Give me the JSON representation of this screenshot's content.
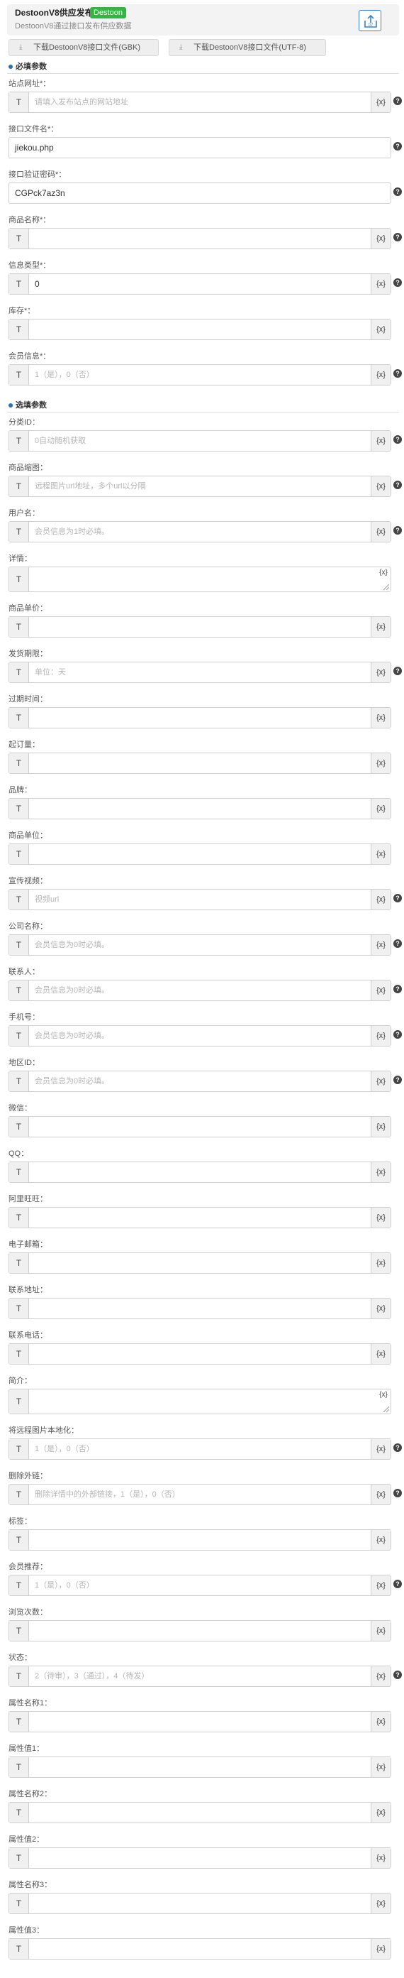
{
  "header": {
    "title": "DestoonV8供应发布",
    "badge": "Destoon",
    "subtitle": "DestoonV8通过接口发布供应数据",
    "share_icon_label": "07"
  },
  "downloads": [
    {
      "label": "下载DestoonV8接口文件(GBK)",
      "icon": "download-icon"
    },
    {
      "label": "下载DestoonV8接口文件(UTF-8)",
      "icon": "download-icon"
    }
  ],
  "sections": {
    "required": "必填参数",
    "optional": "选填参数"
  },
  "common": {
    "t_label": "T",
    "x_label": "{x}",
    "help": "?"
  },
  "required_fields": [
    {
      "label": "站点网址*：",
      "value": "",
      "placeholder": "请填入发布站点的网站地址",
      "kind": "token"
    },
    {
      "label": "接口文件名*：",
      "value": "jiekou.php",
      "placeholder": "",
      "kind": "plain"
    },
    {
      "label": "接口验证密码*：",
      "value": "CGPck7az3n",
      "placeholder": "",
      "kind": "plain"
    },
    {
      "label": "商品名称*：",
      "value": "",
      "placeholder": "",
      "kind": "token"
    },
    {
      "label": "信息类型*：",
      "value": "0",
      "placeholder": "",
      "kind": "token"
    },
    {
      "label": "库存*：",
      "value": "",
      "placeholder": "",
      "kind": "token"
    },
    {
      "label": "会员信息*：",
      "value": "",
      "placeholder": "1（是），0（否）",
      "kind": "token"
    }
  ],
  "optional_fields": [
    {
      "label": "分类ID：",
      "value": "",
      "placeholder": "0自动随机获取",
      "kind": "token"
    },
    {
      "label": "商品缩图：",
      "value": "",
      "placeholder": "远程图片url地址，多个url以分隔",
      "kind": "token"
    },
    {
      "label": "用户名：",
      "value": "",
      "placeholder": "会员信息为1时必填。",
      "kind": "token"
    },
    {
      "label": "详情：",
      "value": "",
      "placeholder": "",
      "kind": "textarea"
    },
    {
      "label": "商品单价：",
      "value": "",
      "placeholder": "",
      "kind": "token"
    },
    {
      "label": "发货期限：",
      "value": "",
      "placeholder": "单位：天",
      "kind": "token"
    },
    {
      "label": "过期时间：",
      "value": "",
      "placeholder": "",
      "kind": "token"
    },
    {
      "label": "起订量：",
      "value": "",
      "placeholder": "",
      "kind": "token"
    },
    {
      "label": "品牌：",
      "value": "",
      "placeholder": "",
      "kind": "token"
    },
    {
      "label": "商品单位：",
      "value": "",
      "placeholder": "",
      "kind": "token"
    },
    {
      "label": "宣传视频：",
      "value": "",
      "placeholder": "视频url",
      "kind": "token"
    },
    {
      "label": "公司名称：",
      "value": "",
      "placeholder": "会员信息为0时必填。",
      "kind": "token"
    },
    {
      "label": "联系人：",
      "value": "",
      "placeholder": "会员信息为0时必填。",
      "kind": "token"
    },
    {
      "label": "手机号：",
      "value": "",
      "placeholder": "会员信息为0时必填。",
      "kind": "token"
    },
    {
      "label": "地区ID：",
      "value": "",
      "placeholder": "会员信息为0时必填。",
      "kind": "token"
    },
    {
      "label": "微信：",
      "value": "",
      "placeholder": "",
      "kind": "token"
    },
    {
      "label": "QQ：",
      "value": "",
      "placeholder": "",
      "kind": "token"
    },
    {
      "label": "阿里旺旺：",
      "value": "",
      "placeholder": "",
      "kind": "token"
    },
    {
      "label": "电子邮箱：",
      "value": "",
      "placeholder": "",
      "kind": "token"
    },
    {
      "label": "联系地址：",
      "value": "",
      "placeholder": "",
      "kind": "token"
    },
    {
      "label": "联系电话：",
      "value": "",
      "placeholder": "",
      "kind": "token"
    },
    {
      "label": "简介：",
      "value": "",
      "placeholder": "",
      "kind": "textarea"
    },
    {
      "label": "将远程图片本地化：",
      "value": "",
      "placeholder": "1（是），0（否）",
      "kind": "token"
    },
    {
      "label": "删除外链：",
      "value": "",
      "placeholder": "删除详情中的外部链接，1（是），0（否）",
      "kind": "token"
    },
    {
      "label": "标签：",
      "value": "",
      "placeholder": "",
      "kind": "token"
    },
    {
      "label": "会员推荐：",
      "value": "",
      "placeholder": "1（是），0（否）",
      "kind": "token"
    },
    {
      "label": "浏览次数：",
      "value": "",
      "placeholder": "",
      "kind": "token"
    },
    {
      "label": "状态：",
      "value": "",
      "placeholder": "2（待审），3（通过），4（待发）",
      "kind": "token"
    },
    {
      "label": "属性名称1：",
      "value": "",
      "placeholder": "",
      "kind": "token"
    },
    {
      "label": "属性值1：",
      "value": "",
      "placeholder": "",
      "kind": "token"
    },
    {
      "label": "属性名称2：",
      "value": "",
      "placeholder": "",
      "kind": "token"
    },
    {
      "label": "属性值2：",
      "value": "",
      "placeholder": "",
      "kind": "token"
    },
    {
      "label": "属性名称3：",
      "value": "",
      "placeholder": "",
      "kind": "token"
    },
    {
      "label": "属性值3：",
      "value": "",
      "placeholder": "",
      "kind": "token"
    }
  ],
  "help_on": {
    "required": [
      true,
      true,
      true,
      true,
      true,
      false,
      true
    ],
    "optional": [
      true,
      true,
      true,
      false,
      false,
      true,
      false,
      false,
      false,
      false,
      true,
      true,
      true,
      true,
      true,
      false,
      false,
      false,
      false,
      false,
      false,
      false,
      true,
      true,
      false,
      true,
      false,
      true,
      false,
      false,
      false,
      false,
      false,
      false
    ]
  }
}
